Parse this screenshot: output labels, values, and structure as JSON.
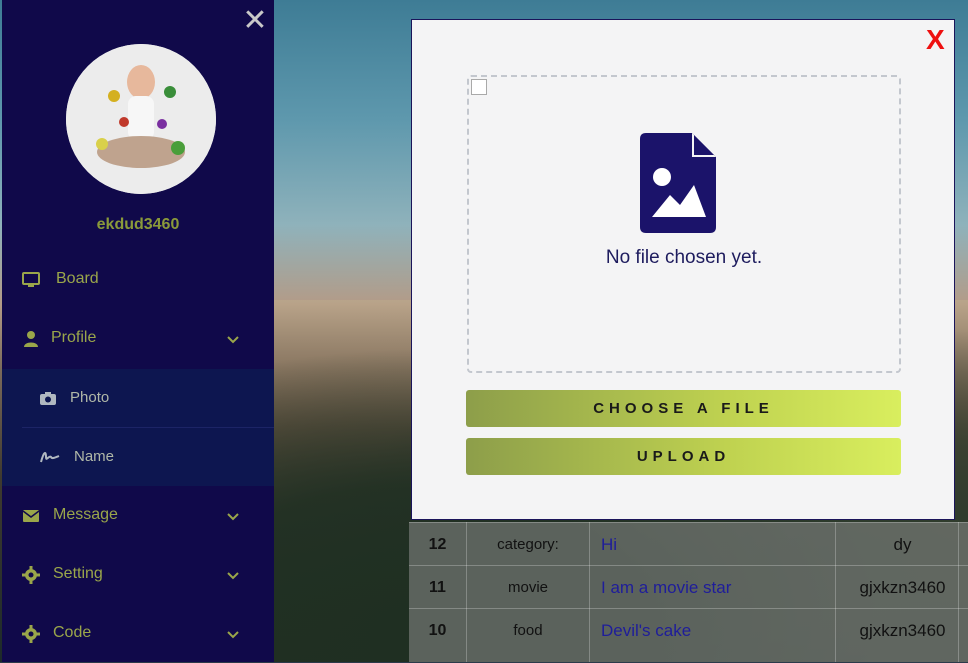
{
  "sidebar": {
    "username": "ekdud3460",
    "items": [
      {
        "label": "Board",
        "icon": "monitor-icon"
      },
      {
        "label": "Profile",
        "icon": "user-icon"
      },
      {
        "label": "Message",
        "icon": "envelope-icon"
      },
      {
        "label": "Setting",
        "icon": "gear-icon"
      },
      {
        "label": "Code",
        "icon": "gear-icon"
      }
    ],
    "subitems": [
      {
        "label": "Photo",
        "icon": "camera-icon"
      },
      {
        "label": "Name",
        "icon": "signature-icon"
      }
    ],
    "colors": {
      "background": "#10094a",
      "accent": "#9aa64a",
      "submenu": "#0d1650"
    }
  },
  "modal": {
    "close_label": "X",
    "status_text": "No file chosen yet.",
    "choose_label": "CHOOSE A FILE",
    "upload_label": "UPLOAD",
    "colors": {
      "close": "#ee1010",
      "icon": "#1b136a"
    }
  },
  "table": {
    "rows": [
      {
        "num": "12",
        "category": "category:",
        "title": "Hi",
        "user": "dy"
      },
      {
        "num": "11",
        "category": "movie",
        "title": "I am a movie star",
        "user": "gjxkzn3460"
      },
      {
        "num": "10",
        "category": "food",
        "title": "Devil's cake",
        "user": "gjxkzn3460"
      }
    ]
  }
}
